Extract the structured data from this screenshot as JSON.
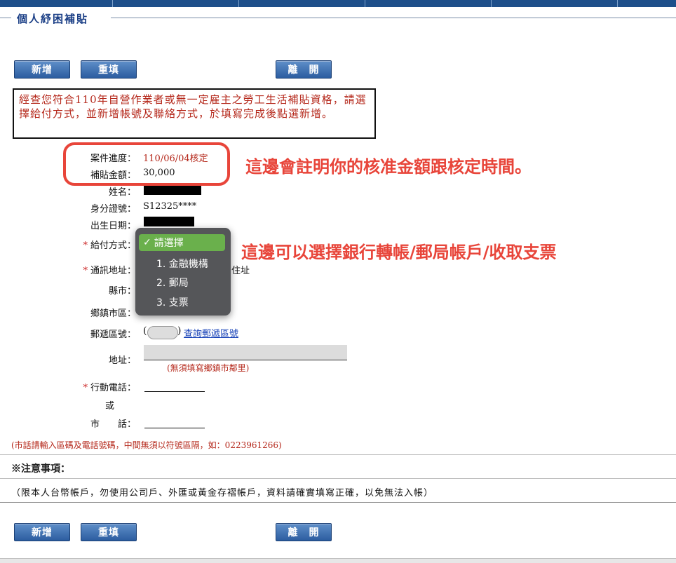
{
  "section": {
    "title": "個人紓困補貼"
  },
  "buttons": {
    "add": "新增",
    "reset": "重填",
    "leave": "離　開"
  },
  "notice": "經查您符合110年自營作業者或無一定雇主之勞工生活補貼資格，請選擇給付方式，並新增帳號及聯絡方式，於填寫完成後點選新增。",
  "annotations": {
    "approval": "這邊會註明你的核准金額跟核定時間。",
    "payment": "這邊可以選擇銀行轉帳/郵局帳戶/收取支票"
  },
  "fields": {
    "case_progress_label": "案件進度：",
    "case_progress_value": "110/06/04核定",
    "subsidy_label": "補貼金額：",
    "subsidy_value": "30,000",
    "name_label": "姓名：",
    "id_label": "身分證號：",
    "id_value": "S12325****",
    "birth_label": "出生日期：",
    "payment_label": "給付方式：",
    "address_label": "通訊地址：",
    "address_suffix": "住址",
    "county_label": "縣市：",
    "township_label": "鄉鎮市區：",
    "zip_label": "郵遞區號：",
    "zip_lookup": "查詢郵遞區號",
    "street_label": "地址：",
    "street_hint": "(無須填寫鄉鎮市鄰里)",
    "mobile_label": "行動電話：",
    "or_label": "或",
    "phone_label": "市　　話：",
    "phone_hint": "(市話請輸入區碼及電話號碼，中間無須以符號區隔，如：0223961266)"
  },
  "dropdown": {
    "selected": "請選擇",
    "options": [
      "1. 金融機構",
      "2. 郵局",
      "3. 支票"
    ]
  },
  "notes": {
    "title": "※注意事項：",
    "text": "（限本人台幣帳戶，勿使用公司戶、外匯或黃金存褶帳戶，資料請確實填寫正確，以免無法入帳）"
  },
  "symbols": {
    "required": "*",
    "check": "✓",
    "paren_open": "(",
    "paren_close": ")"
  },
  "colors": {
    "nav": "#1e4f8a",
    "annotation": "#e8453a",
    "notice_text": "#b5281b",
    "link": "#1a44b8",
    "dropdown_selected": "#6ab04c"
  }
}
